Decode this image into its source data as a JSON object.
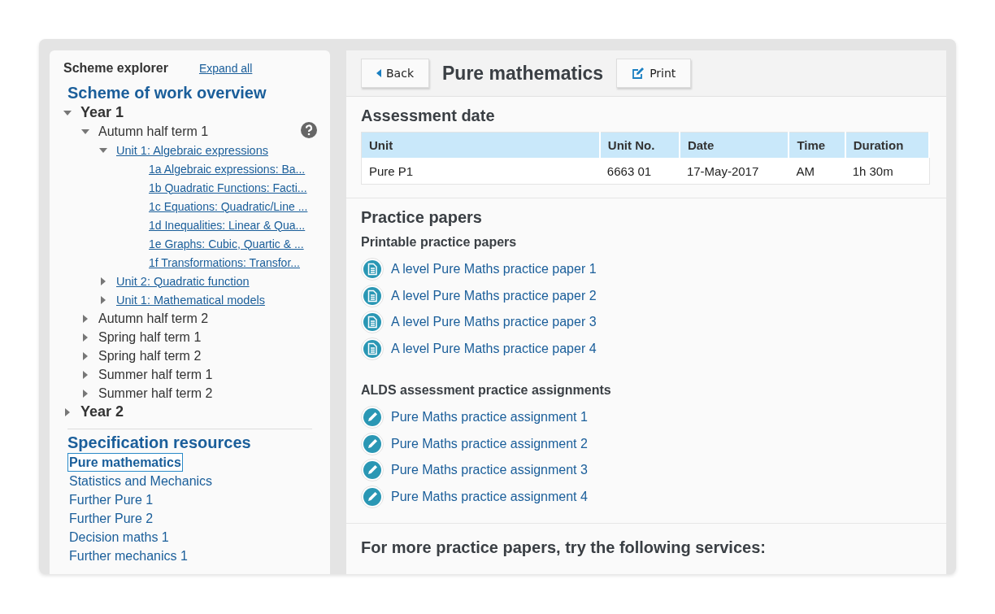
{
  "sidebar": {
    "title": "Scheme explorer",
    "expand_all": "Expand all",
    "overview_heading": "Scheme of work overview",
    "tree": [
      {
        "label": "Year 1",
        "kind": "year",
        "expanded": true,
        "children": [
          {
            "label": "Autumn half term 1",
            "kind": "term",
            "expanded": true,
            "children": [
              {
                "label": "Unit 1: Algebraic expressions",
                "kind": "unit",
                "expanded": true,
                "children": [
                  {
                    "label": "1a Algebraic expressions: Ba...",
                    "kind": "lesson"
                  },
                  {
                    "label": "1b Quadratic Functions: Facti...",
                    "kind": "lesson"
                  },
                  {
                    "label": "1c Equations: Quadratic/Line ...",
                    "kind": "lesson"
                  },
                  {
                    "label": "1d Inequalities: Linear & Qua...",
                    "kind": "lesson"
                  },
                  {
                    "label": "1e Graphs: Cubic, Quartic & ...",
                    "kind": "lesson"
                  },
                  {
                    "label": "1f Transformations: Transfor...",
                    "kind": "lesson"
                  }
                ]
              },
              {
                "label": "Unit 2: Quadratic function",
                "kind": "unit",
                "expanded": false
              },
              {
                "label": "Unit 1: Mathematical models",
                "kind": "unit",
                "expanded": false
              }
            ]
          },
          {
            "label": "Autumn half term 2",
            "kind": "term",
            "expanded": false
          },
          {
            "label": "Spring half term 1",
            "kind": "term",
            "expanded": false
          },
          {
            "label": "Spring half term 2",
            "kind": "term",
            "expanded": false
          },
          {
            "label": "Summer half term 1",
            "kind": "term",
            "expanded": false
          },
          {
            "label": "Summer half term 2",
            "kind": "term",
            "expanded": false
          }
        ]
      },
      {
        "label": "Year 2",
        "kind": "year",
        "expanded": false
      }
    ],
    "spec_heading": "Specification resources",
    "spec_items": [
      {
        "label": "Pure mathematics",
        "selected": true
      },
      {
        "label": "Statistics and Mechanics",
        "selected": false
      },
      {
        "label": "Further Pure 1",
        "selected": false
      },
      {
        "label": "Further Pure 2",
        "selected": false
      },
      {
        "label": "Decision maths 1",
        "selected": false
      },
      {
        "label": "Further mechanics 1",
        "selected": false
      }
    ]
  },
  "header": {
    "back": "Back",
    "title": "Pure mathematics",
    "print": "Print"
  },
  "assessment": {
    "heading": "Assessment date",
    "columns": [
      "Unit",
      "Unit No.",
      "Date",
      "Time",
      "Duration"
    ],
    "rows": [
      [
        "Pure P1",
        "6663 01",
        "17-May-2017",
        "AM",
        "1h 30m"
      ]
    ]
  },
  "practice": {
    "heading": "Practice papers",
    "groups": [
      {
        "title": "Printable practice papers",
        "kind": "paper",
        "items": [
          "A level Pure Maths practice paper 1",
          "A level Pure Maths practice paper 2",
          "A level Pure Maths practice paper 3",
          "A level Pure Maths practice paper 4"
        ]
      },
      {
        "title": "ALDS assessment practice assignments",
        "kind": "assignment",
        "items": [
          "Pure Maths practice assignment 1",
          "Pure Maths practice assignment 2",
          "Pure Maths practice assignment 3",
          "Pure Maths practice assignment 4"
        ]
      }
    ]
  },
  "more": {
    "heading": "For more practice papers, try the following services:"
  }
}
